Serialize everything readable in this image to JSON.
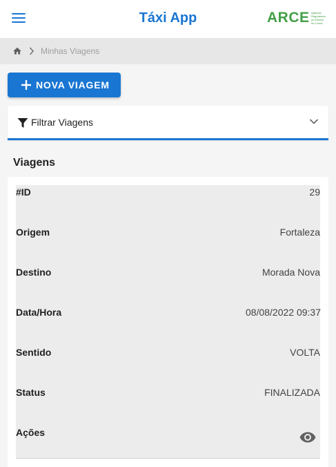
{
  "header": {
    "title": "Táxi App",
    "logo_text": "ARCE",
    "logo_subtext": "Agência Reguladora do Estado do Ceará",
    "brand_color": "#1976d2",
    "logo_color": "#43a047"
  },
  "breadcrumb": {
    "home_icon": "home-icon",
    "current": "Minhas Viagens"
  },
  "actions": {
    "new_trip_label": "NOVA VIAGEM"
  },
  "filter": {
    "label": "Filtrar Viagens"
  },
  "trips": {
    "section_title": "Viagens",
    "fields": [
      {
        "key": "#ID",
        "value": "29"
      },
      {
        "key": "Origem",
        "value": "Fortaleza"
      },
      {
        "key": "Destino",
        "value": "Morada Nova"
      },
      {
        "key": "Data/Hora",
        "value": "08/08/2022 09:37"
      },
      {
        "key": "Sentido",
        "value": "VOLTA"
      },
      {
        "key": "Status",
        "value": "FINALIZADA"
      },
      {
        "key": "Ações",
        "value": ""
      }
    ],
    "action_icon": "eye-icon"
  }
}
